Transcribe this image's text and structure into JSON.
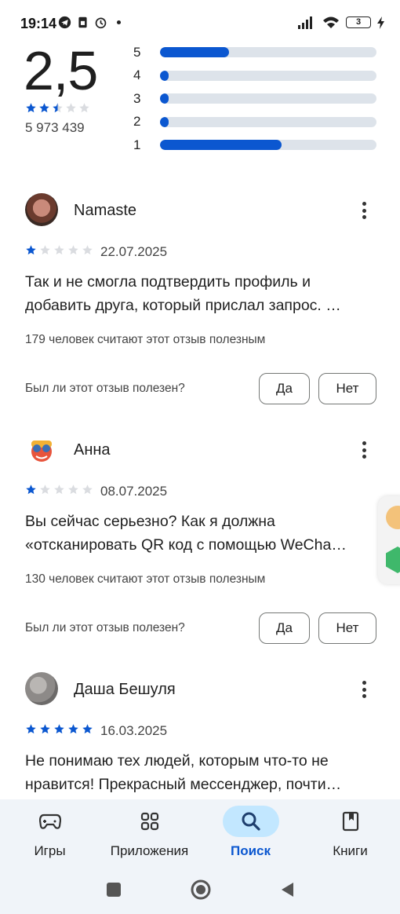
{
  "status_bar": {
    "time": "19:14",
    "battery": "3"
  },
  "rating_summary": {
    "score": "2,5",
    "stars_filled": 2.5,
    "review_count": "5 973 439",
    "distribution": [
      {
        "label": "5",
        "fraction": 0.32
      },
      {
        "label": "4",
        "fraction": 0.04
      },
      {
        "label": "3",
        "fraction": 0.04
      },
      {
        "label": "2",
        "fraction": 0.04
      },
      {
        "label": "1",
        "fraction": 0.56
      }
    ]
  },
  "reviews": [
    {
      "author": "Namaste",
      "stars": 1,
      "date": "22.07.2025",
      "text_line1": "Так и не смогла подтвердить профиль и",
      "text_line2": "добавить друга, который прислал запрос. …",
      "helpful_count": "179 человек считают этот отзыв полезным",
      "helpful_question": "Был ли этот отзыв полезен?",
      "yes_label": "Да",
      "no_label": "Нет"
    },
    {
      "author": "Анна",
      "stars": 1,
      "date": "08.07.2025",
      "text_line1": "Вы сейчас серьезно? Как я должна",
      "text_line2": "«отсканировать QR код с помощью WeCha…",
      "helpful_count": "130 человек считают этот отзыв полезным",
      "helpful_question": "Был ли этот отзыв полезен?",
      "yes_label": "Да",
      "no_label": "Нет"
    },
    {
      "author": "Даша Бешуля",
      "stars": 5,
      "date": "16.03.2025",
      "text_line1": "Не понимаю тех людей, которым что-то не",
      "text_line2": "нравится! Прекрасный мессенджер, почти…"
    }
  ],
  "bottom_nav": {
    "items": [
      {
        "label": "Игры",
        "icon": "gamepad-icon",
        "active": false
      },
      {
        "label": "Приложения",
        "icon": "apps-grid-icon",
        "active": false
      },
      {
        "label": "Поиск",
        "icon": "search-icon",
        "active": true
      },
      {
        "label": "Книги",
        "icon": "book-icon",
        "active": false
      }
    ]
  },
  "colors": {
    "accent": "#0b57d0",
    "star_empty": "#dadce0",
    "nav_bg": "#f0f4f9",
    "nav_active_pill": "#c2e7ff"
  }
}
